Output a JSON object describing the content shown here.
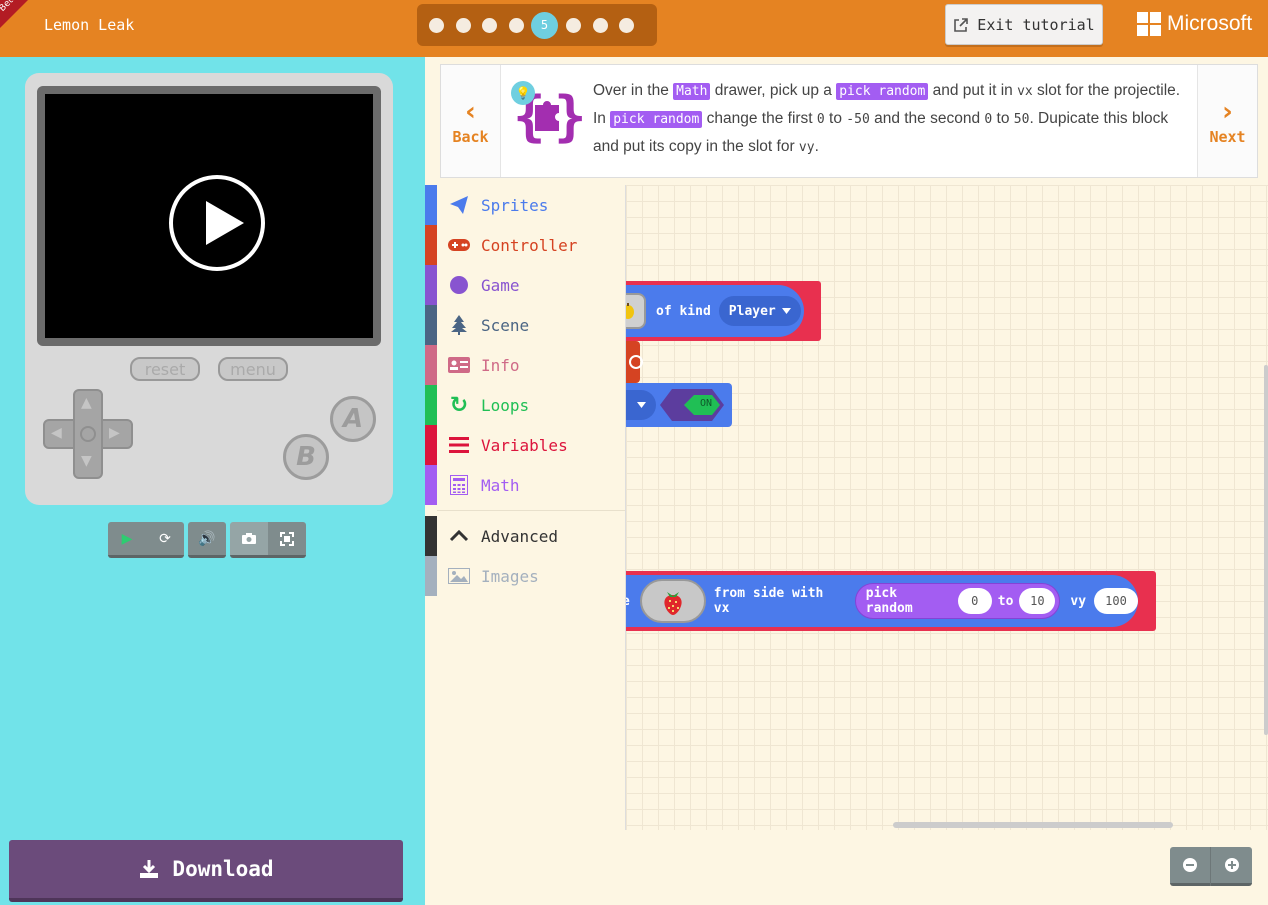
{
  "header": {
    "beta_label": "Beta",
    "project_name": "Lemon Leak",
    "steps": [
      "1",
      "2",
      "3",
      "4",
      "5",
      "6",
      "7",
      "8"
    ],
    "current_step": "5",
    "exit_label": "Exit tutorial",
    "brand": "Microsoft",
    "color": "#e58322"
  },
  "simulator": {
    "reset_label": "reset",
    "menu_label": "menu",
    "a_label": "A",
    "b_label": "B",
    "download_label": "Download",
    "bg_color": "#71e3e9",
    "toolbar_icons": [
      "play-icon",
      "restart-icon",
      "sound-icon",
      "screenshot-icon",
      "fullscreen-icon"
    ]
  },
  "instructions": {
    "back_label": "Back",
    "next_label": "Next",
    "t1": "Over in the ",
    "chip_math": "Math",
    "t2": " drawer, pick up a ",
    "chip_pick": "pick random",
    "t3": " and put it in ",
    "code_vx": "vx",
    "t4": " slot for the projectile. In ",
    "chip_pick2": "pick random",
    "t5": " change the first ",
    "code_0": "0",
    "t6": " to ",
    "code_m50": "-50",
    "t7": " and the second ",
    "code_0b": "0",
    "t8": " to ",
    "code_50": "50",
    "t9": ". Dupicate this block and put its copy in the slot for ",
    "code_vy": "vy",
    "t10": "."
  },
  "toolbox": {
    "items": [
      {
        "label": "Sprites",
        "color": "#4b7bec"
      },
      {
        "label": "Controller",
        "color": "#d54322"
      },
      {
        "label": "Game",
        "color": "#8854d0"
      },
      {
        "label": "Scene",
        "color": "#4b6584"
      },
      {
        "label": "Info",
        "color": "#cf6a87"
      },
      {
        "label": "Loops",
        "color": "#20bf55"
      },
      {
        "label": "Variables",
        "color": "#dc143c"
      },
      {
        "label": "Math",
        "color": "#a35df2"
      },
      {
        "label": "Advanced",
        "color": "#333333"
      },
      {
        "label": "Images",
        "color": "#a4b0be"
      }
    ]
  },
  "workspace": {
    "block1_kind_label": "of kind",
    "block1_kind_value": "Player",
    "toggle_value": "ON",
    "block4_prefix": "e",
    "block4_from_side": "from side with vx",
    "pick_random_label": "pick random",
    "pick_min": "0",
    "pick_to": "to",
    "pick_max": "10",
    "vy_label": "vy",
    "vy_value": "100"
  }
}
